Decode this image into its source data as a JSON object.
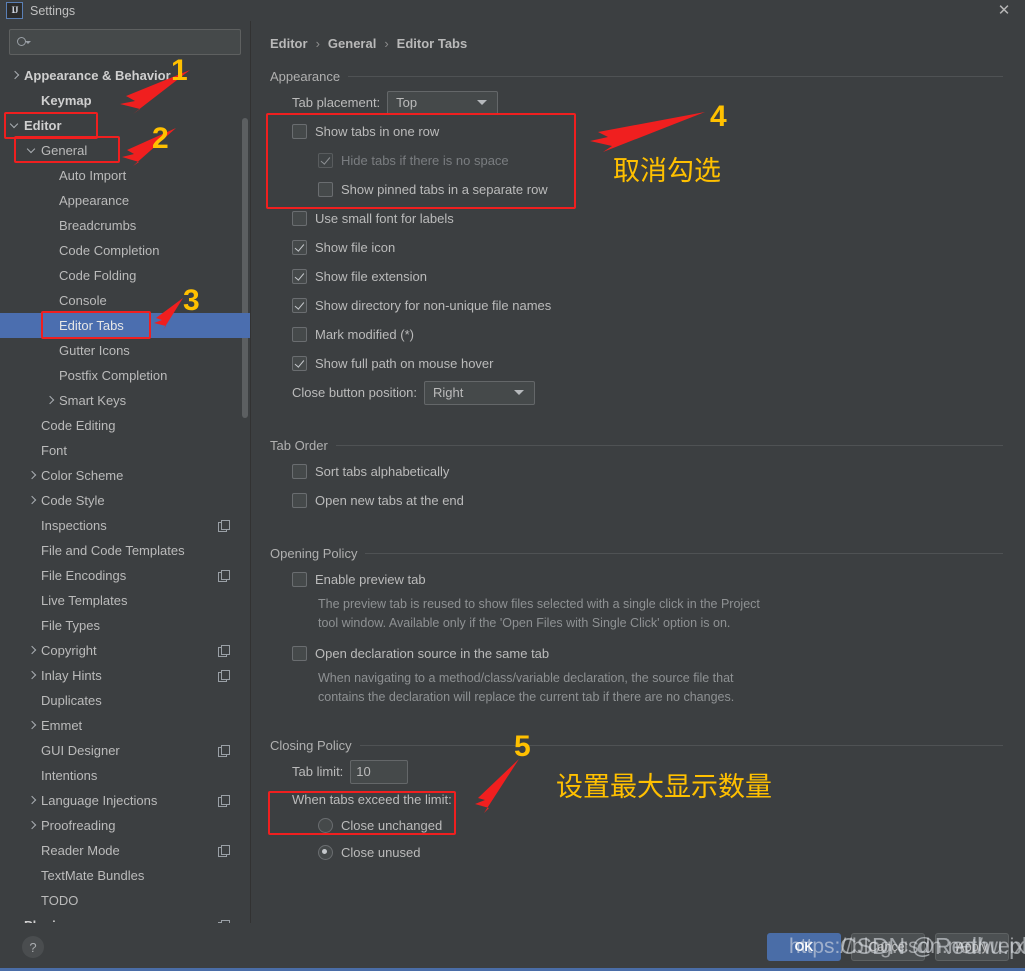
{
  "window": {
    "title": "Settings",
    "app_icon": "intellij-idea-icon",
    "close_icon": "close-icon"
  },
  "search": {
    "placeholder": "",
    "value": "",
    "icon": "search-icon"
  },
  "sidebar": {
    "items": [
      {
        "label": "Appearance & Behavior",
        "indent": 0,
        "arrow": "right",
        "bold": true,
        "selected": false,
        "project_icon": false
      },
      {
        "label": "Keymap",
        "indent": 1,
        "arrow": "none",
        "bold": true,
        "selected": false,
        "project_icon": false
      },
      {
        "label": "Editor",
        "indent": 0,
        "arrow": "down",
        "bold": true,
        "selected": false,
        "project_icon": false
      },
      {
        "label": "General",
        "indent": 1,
        "arrow": "down",
        "bold": false,
        "selected": false,
        "project_icon": false
      },
      {
        "label": "Auto Import",
        "indent": 2,
        "arrow": "none",
        "bold": false,
        "selected": false,
        "project_icon": false
      },
      {
        "label": "Appearance",
        "indent": 2,
        "arrow": "none",
        "bold": false,
        "selected": false,
        "project_icon": false
      },
      {
        "label": "Breadcrumbs",
        "indent": 2,
        "arrow": "none",
        "bold": false,
        "selected": false,
        "project_icon": false
      },
      {
        "label": "Code Completion",
        "indent": 2,
        "arrow": "none",
        "bold": false,
        "selected": false,
        "project_icon": false
      },
      {
        "label": "Code Folding",
        "indent": 2,
        "arrow": "none",
        "bold": false,
        "selected": false,
        "project_icon": false
      },
      {
        "label": "Console",
        "indent": 2,
        "arrow": "none",
        "bold": false,
        "selected": false,
        "project_icon": false
      },
      {
        "label": "Editor Tabs",
        "indent": 2,
        "arrow": "none",
        "bold": false,
        "selected": true,
        "project_icon": false
      },
      {
        "label": "Gutter Icons",
        "indent": 2,
        "arrow": "none",
        "bold": false,
        "selected": false,
        "project_icon": false
      },
      {
        "label": "Postfix Completion",
        "indent": 2,
        "arrow": "none",
        "bold": false,
        "selected": false,
        "project_icon": false
      },
      {
        "label": "Smart Keys",
        "indent": 2,
        "arrow": "right",
        "bold": false,
        "selected": false,
        "project_icon": false
      },
      {
        "label": "Code Editing",
        "indent": 1,
        "arrow": "none",
        "bold": false,
        "selected": false,
        "project_icon": false
      },
      {
        "label": "Font",
        "indent": 1,
        "arrow": "none",
        "bold": false,
        "selected": false,
        "project_icon": false
      },
      {
        "label": "Color Scheme",
        "indent": 1,
        "arrow": "right",
        "bold": false,
        "selected": false,
        "project_icon": false
      },
      {
        "label": "Code Style",
        "indent": 1,
        "arrow": "right",
        "bold": false,
        "selected": false,
        "project_icon": false
      },
      {
        "label": "Inspections",
        "indent": 1,
        "arrow": "none",
        "bold": false,
        "selected": false,
        "project_icon": true
      },
      {
        "label": "File and Code Templates",
        "indent": 1,
        "arrow": "none",
        "bold": false,
        "selected": false,
        "project_icon": false
      },
      {
        "label": "File Encodings",
        "indent": 1,
        "arrow": "none",
        "bold": false,
        "selected": false,
        "project_icon": true
      },
      {
        "label": "Live Templates",
        "indent": 1,
        "arrow": "none",
        "bold": false,
        "selected": false,
        "project_icon": false
      },
      {
        "label": "File Types",
        "indent": 1,
        "arrow": "none",
        "bold": false,
        "selected": false,
        "project_icon": false
      },
      {
        "label": "Copyright",
        "indent": 1,
        "arrow": "right",
        "bold": false,
        "selected": false,
        "project_icon": true
      },
      {
        "label": "Inlay Hints",
        "indent": 1,
        "arrow": "right",
        "bold": false,
        "selected": false,
        "project_icon": true
      },
      {
        "label": "Duplicates",
        "indent": 1,
        "arrow": "none",
        "bold": false,
        "selected": false,
        "project_icon": false
      },
      {
        "label": "Emmet",
        "indent": 1,
        "arrow": "right",
        "bold": false,
        "selected": false,
        "project_icon": false
      },
      {
        "label": "GUI Designer",
        "indent": 1,
        "arrow": "none",
        "bold": false,
        "selected": false,
        "project_icon": true
      },
      {
        "label": "Intentions",
        "indent": 1,
        "arrow": "none",
        "bold": false,
        "selected": false,
        "project_icon": false
      },
      {
        "label": "Language Injections",
        "indent": 1,
        "arrow": "right",
        "bold": false,
        "selected": false,
        "project_icon": true
      },
      {
        "label": "Proofreading",
        "indent": 1,
        "arrow": "right",
        "bold": false,
        "selected": false,
        "project_icon": false
      },
      {
        "label": "Reader Mode",
        "indent": 1,
        "arrow": "none",
        "bold": false,
        "selected": false,
        "project_icon": true
      },
      {
        "label": "TextMate Bundles",
        "indent": 1,
        "arrow": "none",
        "bold": false,
        "selected": false,
        "project_icon": false
      },
      {
        "label": "TODO",
        "indent": 1,
        "arrow": "none",
        "bold": false,
        "selected": false,
        "project_icon": false
      },
      {
        "label": "Plugins",
        "indent": 0,
        "arrow": "none",
        "bold": true,
        "selected": false,
        "project_icon": true
      }
    ]
  },
  "breadcrumb": {
    "items": [
      "Editor",
      "General",
      "Editor Tabs"
    ],
    "separator": "›"
  },
  "main": {
    "appearance": {
      "title": "Appearance",
      "tab_placement_label": "Tab placement:",
      "tab_placement_value": "Top",
      "show_tabs_one_row": {
        "label": "Show tabs in one row",
        "checked": false,
        "disabled": false
      },
      "hide_tabs_no_space": {
        "label": "Hide tabs if there is no space",
        "checked": true,
        "disabled": true
      },
      "show_pinned_separate": {
        "label": "Show pinned tabs in a separate row",
        "checked": false,
        "disabled": false
      },
      "use_small_font": {
        "label": "Use small font for labels",
        "checked": false,
        "disabled": false
      },
      "show_file_icon": {
        "label": "Show file icon",
        "checked": true,
        "disabled": false
      },
      "show_file_extension": {
        "label": "Show file extension",
        "checked": true,
        "disabled": false
      },
      "show_directory": {
        "label": "Show directory for non-unique file names",
        "checked": true,
        "disabled": false
      },
      "mark_modified": {
        "label": "Mark modified (*)",
        "checked": false,
        "disabled": false
      },
      "show_full_path": {
        "label": "Show full path on mouse hover",
        "checked": true,
        "disabled": false
      },
      "close_button_label": "Close button position:",
      "close_button_value": "Right"
    },
    "tab_order": {
      "title": "Tab Order",
      "sort_alphabetically": {
        "label": "Sort tabs alphabetically",
        "checked": false
      },
      "open_new_end": {
        "label": "Open new tabs at the end",
        "checked": false
      }
    },
    "opening_policy": {
      "title": "Opening Policy",
      "enable_preview": {
        "label": "Enable preview tab",
        "checked": false
      },
      "enable_preview_desc": "The preview tab is reused to show files selected with a single click in the Project tool window. Available only if the 'Open Files with Single Click' option is on.",
      "open_declaration": {
        "label": "Open declaration source in the same tab",
        "checked": false
      },
      "open_declaration_desc": "When navigating to a method/class/variable declaration, the source file that contains the declaration will replace the current tab if there are no changes."
    },
    "closing_policy": {
      "title": "Closing Policy",
      "tab_limit_label": "Tab limit:",
      "tab_limit_value": "10",
      "when_exceed_label": "When tabs exceed the limit:",
      "close_unchanged": {
        "label": "Close unchanged",
        "checked": false
      },
      "close_unused": {
        "label": "Close unused",
        "checked": true
      }
    }
  },
  "footer": {
    "help_label": "?",
    "ok": "OK",
    "cancel": "Cancel",
    "apply": "Apply"
  },
  "annotations": {
    "markers": [
      {
        "id": "1",
        "text": "1"
      },
      {
        "id": "2",
        "text": "2"
      },
      {
        "id": "3",
        "text": "3"
      },
      {
        "id": "4",
        "text": "4"
      },
      {
        "id": "5",
        "text": "5"
      }
    ],
    "note_uncheck": "取消勾选",
    "note_max_count": "设置最大显示数量",
    "highlight_color": "#f01f1f",
    "marker_color": "#ffc000"
  },
  "watermark": {
    "line1": "https://blog.csdn.net/weixin",
    "line2": "CSDN @Redhu.ph"
  }
}
